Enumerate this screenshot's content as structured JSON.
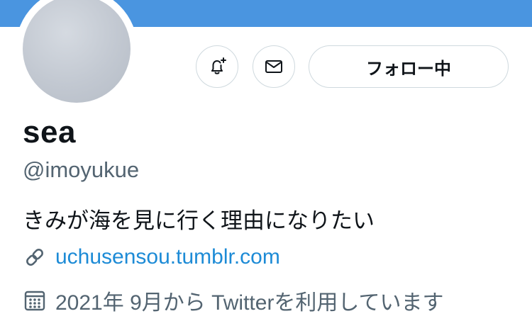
{
  "colors": {
    "banner": "#4a95e0",
    "link": "#1d8bd6",
    "secondary_text": "#536471",
    "border": "#cfd9de"
  },
  "profile": {
    "display_name": "sea",
    "handle": "@imoyukue",
    "bio": "きみが海を見に行く理由になりたい",
    "website": "uchusensou.tumblr.com",
    "joined": "2021年 9月から Twitterを利用しています"
  },
  "actions": {
    "notify_icon": "bell-plus-icon",
    "message_icon": "envelope-icon",
    "follow_label": "フォロー中"
  },
  "meta_icons": {
    "link_icon": "link-icon",
    "calendar_icon": "calendar-icon"
  }
}
